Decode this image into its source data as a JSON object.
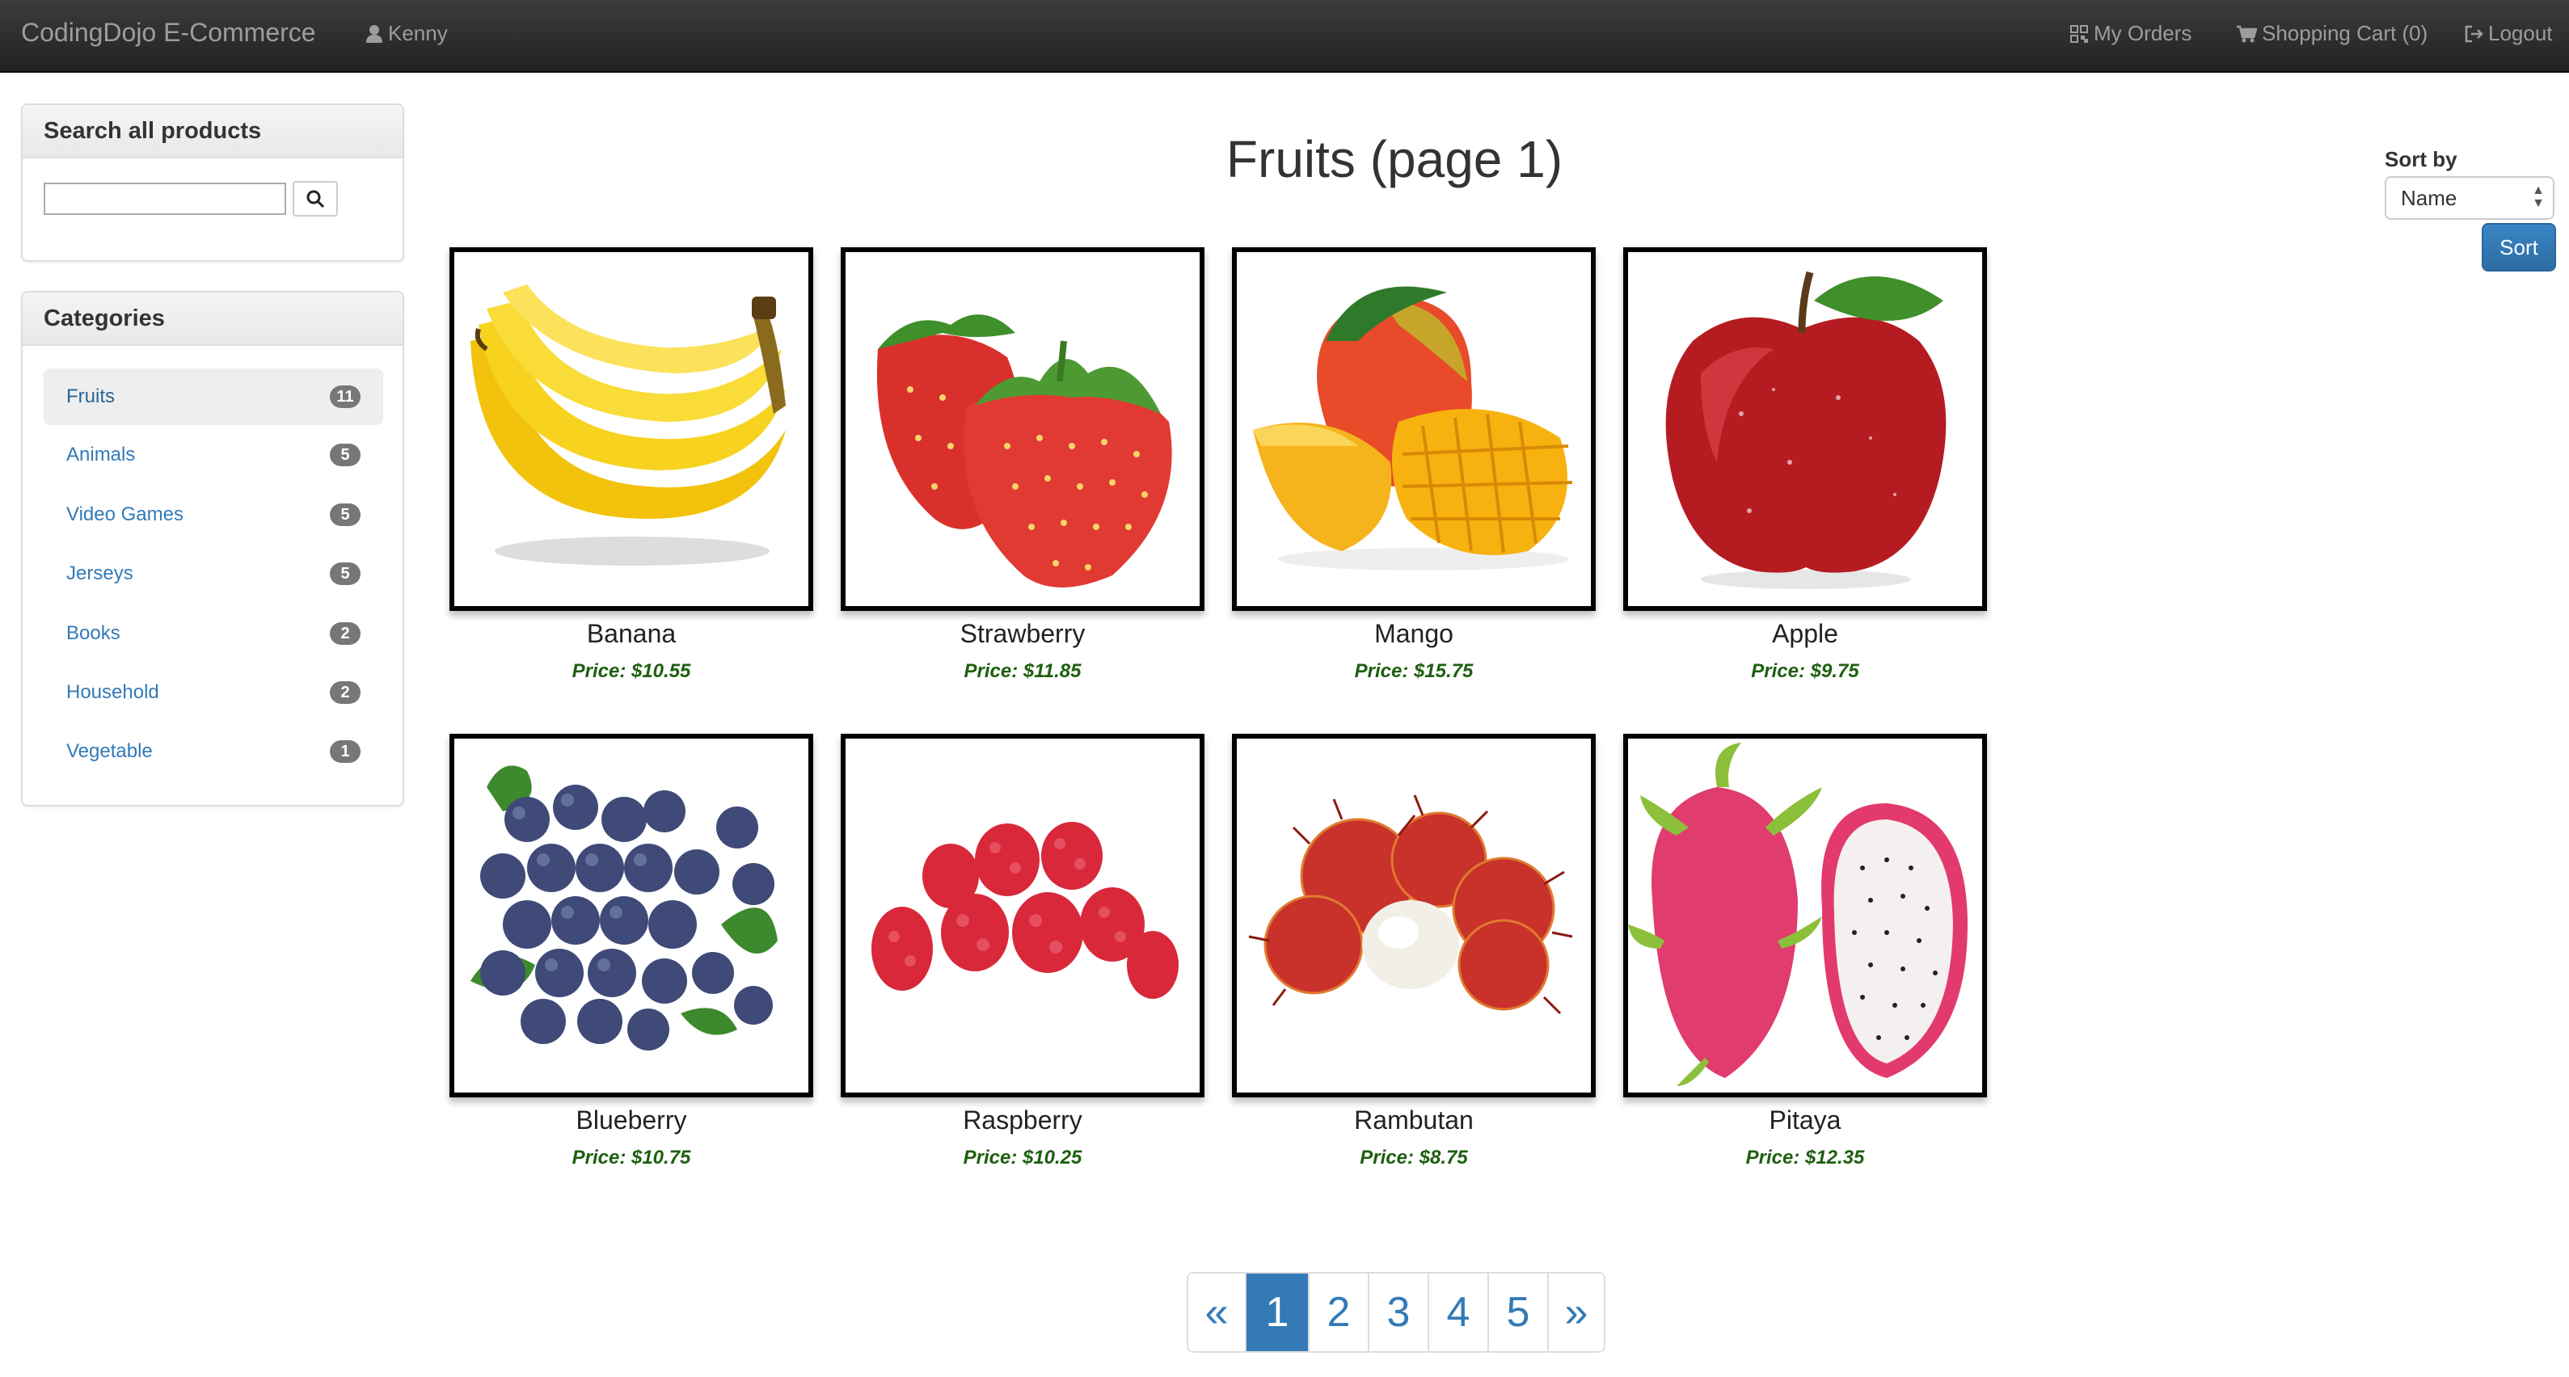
{
  "navbar": {
    "brand": "CodingDojo E-Commerce",
    "user": "Kenny",
    "my_orders": "My Orders",
    "cart": "Shopping Cart (0)",
    "logout": "Logout"
  },
  "search": {
    "heading": "Search all products",
    "value": ""
  },
  "categories": {
    "heading": "Categories",
    "items": [
      {
        "label": "Fruits",
        "count": "11",
        "active": true
      },
      {
        "label": "Animals",
        "count": "5"
      },
      {
        "label": "Video Games",
        "count": "5"
      },
      {
        "label": "Jerseys",
        "count": "5"
      },
      {
        "label": "Books",
        "count": "2"
      },
      {
        "label": "Household",
        "count": "2"
      },
      {
        "label": "Vegetable",
        "count": "1"
      }
    ]
  },
  "main": {
    "title": "Fruits (page 1)",
    "sort_label": "Sort by",
    "sort_value": "Name",
    "sort_button": "Sort"
  },
  "products": [
    {
      "name": "Banana",
      "price": "Price: $10.55",
      "image": "banana"
    },
    {
      "name": "Strawberry",
      "price": "Price: $11.85",
      "image": "strawberry"
    },
    {
      "name": "Mango",
      "price": "Price: $15.75",
      "image": "mango"
    },
    {
      "name": "Apple",
      "price": "Price: $9.75",
      "image": "apple"
    },
    {
      "name": "Blueberry",
      "price": "Price: $10.75",
      "image": "blueberry"
    },
    {
      "name": "Raspberry",
      "price": "Price: $10.25",
      "image": "raspberry"
    },
    {
      "name": "Rambutan",
      "price": "Price: $8.75",
      "image": "rambutan"
    },
    {
      "name": "Pitaya",
      "price": "Price: $12.35",
      "image": "pitaya"
    }
  ],
  "pagination": {
    "prev": "«",
    "pages": [
      "1",
      "2",
      "3",
      "4",
      "5"
    ],
    "current": "1",
    "next": "»"
  },
  "colors": {
    "link": "#337ab7",
    "price": "#1e5f10",
    "navbar": "#222222",
    "badge": "#777777"
  }
}
